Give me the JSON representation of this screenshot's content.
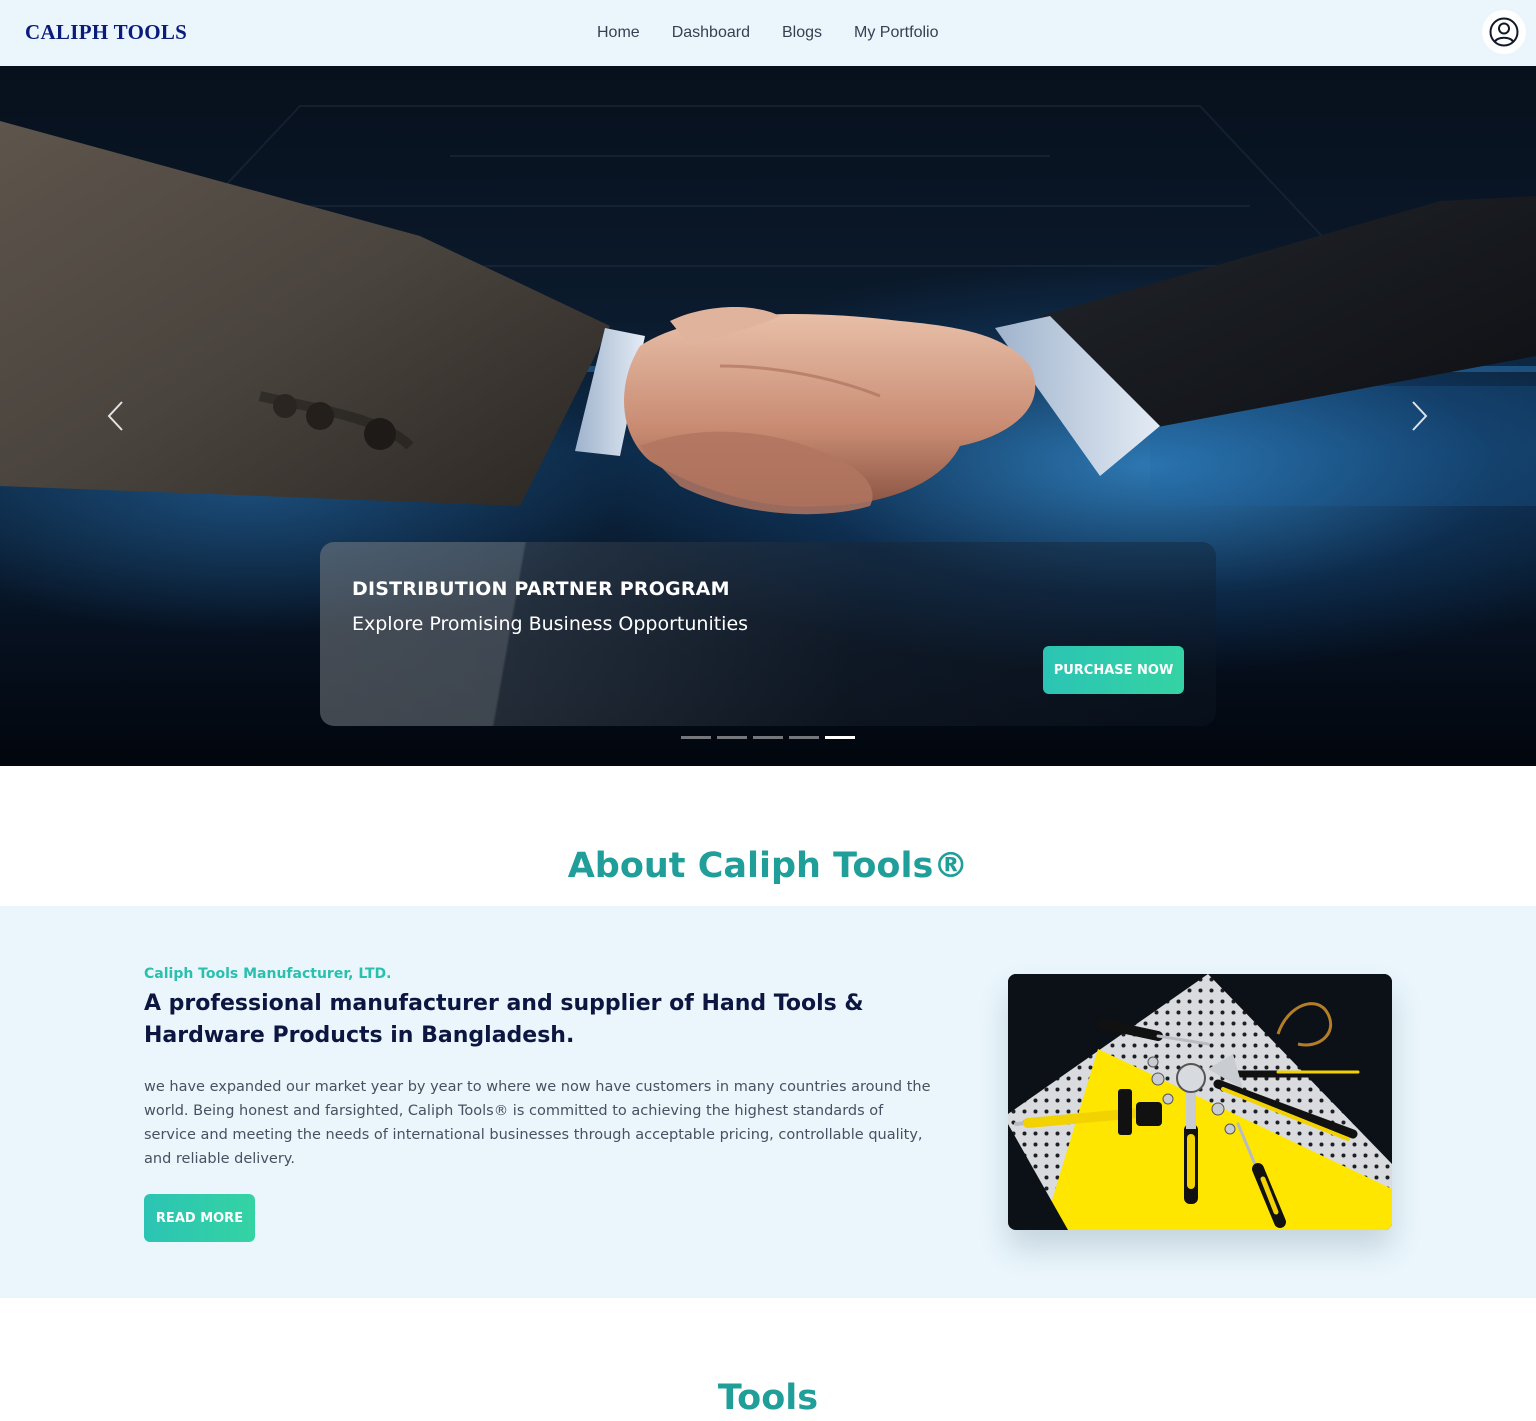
{
  "navbar": {
    "brand": "CALIPH TOOLS",
    "links": [
      "Home",
      "Dashboard",
      "Blogs",
      "My Portfolio"
    ],
    "avatar_icon": "user-circle-icon"
  },
  "hero": {
    "caption_title": "DISTRIBUTION PARTNER PROGRAM",
    "caption_subtitle": "Explore Promising Business Opportunities",
    "cta_label": "PURCHASE NOW",
    "slide_count": 5,
    "active_slide": 5,
    "prev_icon": "chevron-left-icon",
    "next_icon": "chevron-right-icon"
  },
  "about": {
    "section_title": "About Caliph Tools®",
    "kicker": "Caliph Tools Manufacturer, LTD.",
    "heading": "A professional manufacturer and supplier of Hand Tools & Hardware Products in Bangladesh.",
    "body": "we have expanded our market year by year to where we now have customers in many countries around the world. Being honest and farsighted, Caliph Tools® is committed to achieving the highest standards of service and meeting the needs of international businesses through acceptable pricing, controllable quality, and reliable delivery.",
    "cta_label": "READ MORE"
  },
  "tools": {
    "section_title": "Tools"
  },
  "colors": {
    "accent": "#2bc4b4",
    "title_teal": "#1f9e9a",
    "brand_navy": "#0b1b7a",
    "section_bg": "#eaf6fc"
  }
}
